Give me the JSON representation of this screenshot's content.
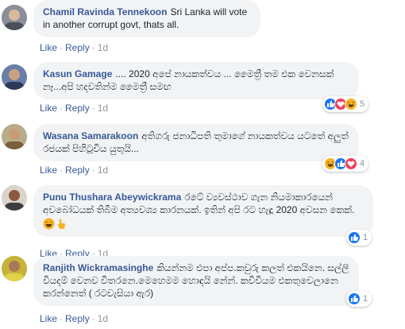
{
  "comments": [
    {
      "author": "Chamil Ravinda Tennekoon",
      "text": "Sri Lanka will vote in another corrupt govt, thats all.",
      "like": "Like",
      "reply": "Reply",
      "time": "1d"
    },
    {
      "author": "Kasun Gamage",
      "text": ".... 2020 අපේ නායකත්වය ... මෛත්‍රී තම එක වෙනසක් නෑ...අපි හදවතින්ම මෛත්‍රී සමඟ",
      "like": "Like",
      "reply": "Reply",
      "time": "1d",
      "reaction_icons": [
        "like-icon",
        "love-icon",
        "haha-icon"
      ],
      "reaction_count": "5"
    },
    {
      "author": "Wasana Samarakoon",
      "text": "අතිගරු ජනාධිපති තුමාගේ නායකත්වය යටතේ අලුත් රජයක් පිහිටුවිය යුතුයි...",
      "like": "Like",
      "reply": "Reply",
      "time": "1d",
      "reaction_icons": [
        "haha-icon",
        "like-icon",
        "love-icon"
      ],
      "reaction_count": "4"
    },
    {
      "author": "Punu Thushara Abeywickrama",
      "text": "රටේ ව්‍යවස්ථාව ගැන නියමාකාරයෙන් අවබෝධයක් තිබීම අත්‍යවශ්‍ය කාරනයක්. ඉතින් අපි රට හැඳූ 2020 අවසන කෙක්.",
      "inline_emoji": [
        "haha-icon",
        "point-icon"
      ],
      "like": "Like",
      "reply": "Reply",
      "time": "1d",
      "reaction_icons": [
        "like-icon"
      ],
      "reaction_count": "1"
    },
    {
      "author": "Ranjith Wickramasinghe",
      "text": "කියන්නම එපා අප්ප.කවුරු කලත් එකයිනෙ. සල්ලි වියදම් වෙනව විතරනෙ.මෙහෙමම හොඳයි නේන්. කවිවියම එකතුවෙලානෙ කරන්නෙත් ( රටවැසියා ඇර)",
      "like": "Like",
      "reply": "Reply",
      "time": "1d",
      "reaction_icons": [
        "like-icon"
      ],
      "reaction_count": "1"
    }
  ],
  "colors": {
    "author": "#385898",
    "bubble": "#f2f3f5",
    "meta": "#90949c",
    "like": "#1877f2",
    "love": "#f33e58",
    "haha": "#f7b125"
  }
}
